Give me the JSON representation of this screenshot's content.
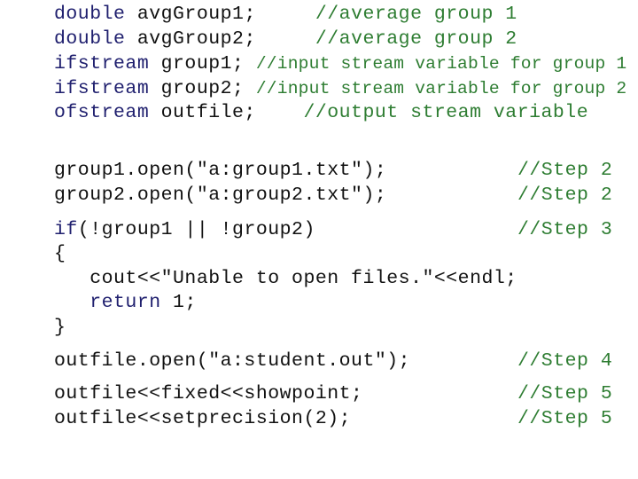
{
  "colors": {
    "code": "#111111",
    "keyword": "#1f1f6e",
    "comment": "#2e7d32"
  },
  "declarations": [
    {
      "keyword": "double",
      "rest": " avgGroup1;     ",
      "comment": "//average group 1"
    },
    {
      "keyword": "double",
      "rest": " avgGroup2;     ",
      "comment": "//average group 2"
    },
    {
      "keyword": "ifstream",
      "rest": " group1; ",
      "comment": "//input stream variable for group 1"
    },
    {
      "keyword": "ifstream",
      "rest": " group2; ",
      "comment": "//input stream variable for group 2"
    },
    {
      "keyword": "ofstream",
      "rest": " outfile;    ",
      "comment": "//output stream variable"
    }
  ],
  "open_lines": [
    {
      "code": "group1.open(\"a:group1.txt\");",
      "comment": "//Step 2"
    },
    {
      "code": "group2.open(\"a:group2.txt\");",
      "comment": "//Step 2"
    }
  ],
  "if_block": {
    "if_keyword": "if",
    "if_rest": "(!group1 || !group2)",
    "if_comment": "//Step 3",
    "open_brace": "{",
    "cout_line": "   cout<<\"Unable to open files.\"<<endl;",
    "return_indent": "   ",
    "return_keyword": "return",
    "return_rest": " 1;",
    "close_brace": "}"
  },
  "outfile_open": {
    "code": "outfile.open(\"a:student.out\");",
    "comment": "//Step 4"
  },
  "format_lines": [
    {
      "code": "outfile<<fixed<<showpoint;",
      "comment": "//Step 5"
    },
    {
      "code": "outfile<<setprecision(2);",
      "comment": "//Step 5"
    }
  ]
}
